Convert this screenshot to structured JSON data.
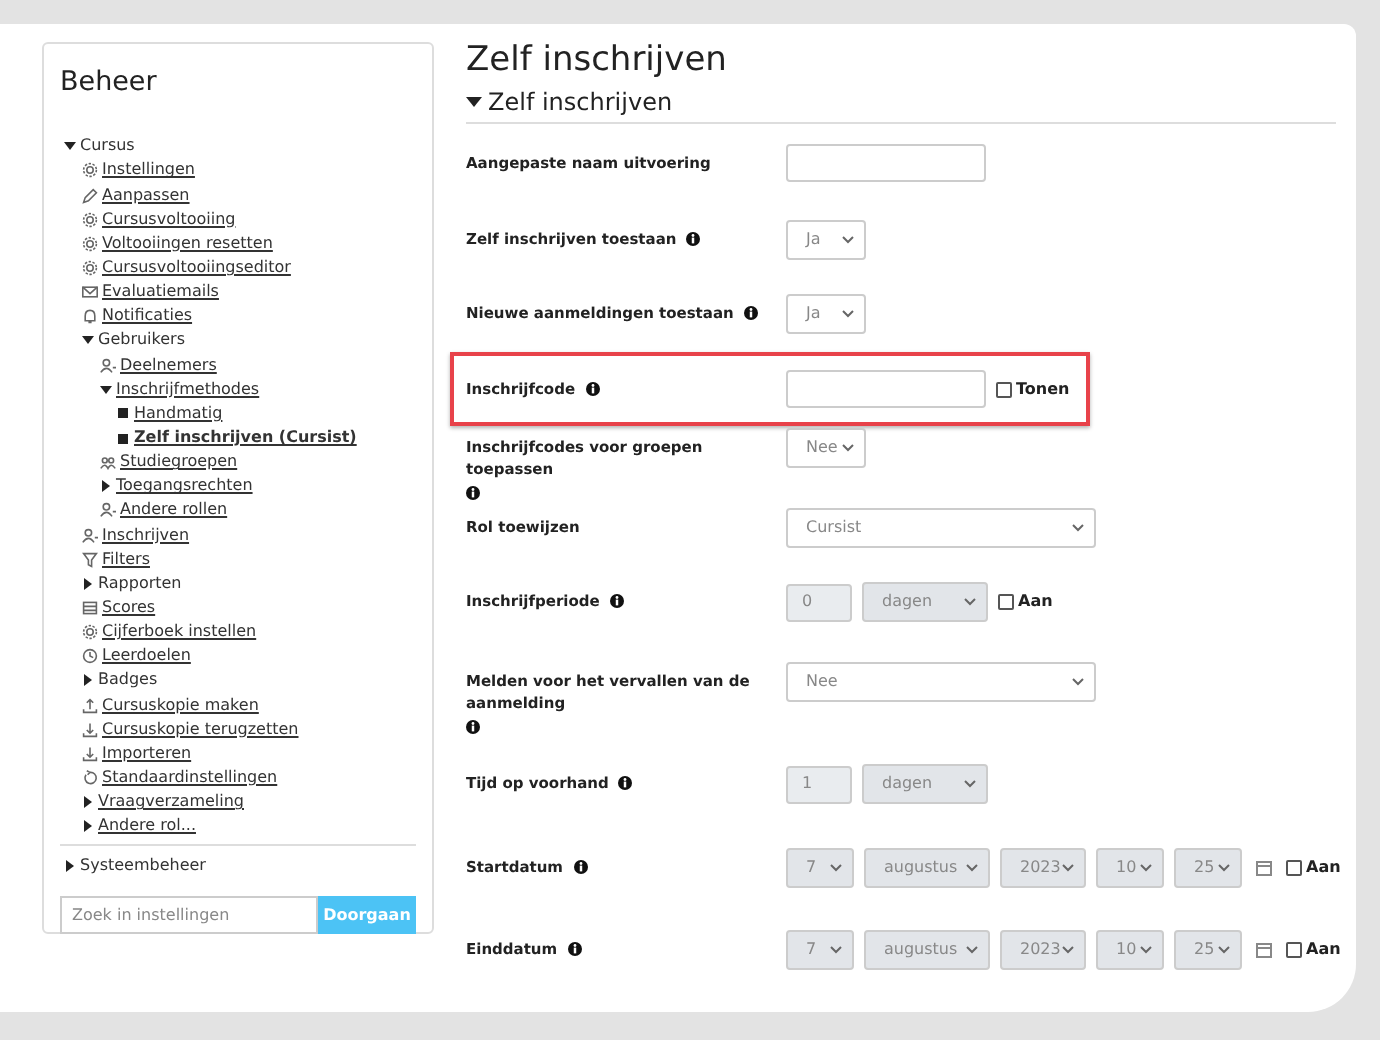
{
  "sidebar": {
    "title": "Beheer",
    "tree": [
      {
        "label": "Cursus",
        "kind": "branch",
        "expanded": true,
        "link": false,
        "selected": false,
        "children": [
          {
            "label": "Instellingen",
            "kind": "gear",
            "link": true,
            "selected": false
          },
          {
            "label": "Aanpassen",
            "kind": "pencil",
            "link": true,
            "selected": false
          },
          {
            "label": "Cursusvoltooiing",
            "kind": "gear",
            "link": true,
            "selected": false
          },
          {
            "label": "Voltooiingen resetten",
            "kind": "gear",
            "link": true,
            "selected": false
          },
          {
            "label": "Cursusvoltooiingseditor",
            "kind": "gear",
            "link": true,
            "selected": false
          },
          {
            "label": "Evaluatiemails",
            "kind": "mail",
            "link": true,
            "selected": false
          },
          {
            "label": "Notificaties",
            "kind": "bell",
            "link": true,
            "selected": false
          },
          {
            "label": "Gebruikers",
            "kind": "branch",
            "expanded": true,
            "link": false,
            "selected": false,
            "children": [
              {
                "label": "Deelnemers",
                "kind": "user",
                "link": true,
                "selected": false
              },
              {
                "label": "Inschrijfmethodes",
                "kind": "branch",
                "expanded": true,
                "link": true,
                "selected": false,
                "children": [
                  {
                    "label": "Handmatig",
                    "kind": "leaf",
                    "link": true,
                    "selected": false
                  },
                  {
                    "label": "Zelf inschrijven (Cursist)",
                    "kind": "leaf",
                    "link": true,
                    "selected": true
                  }
                ]
              },
              {
                "label": "Studiegroepen",
                "kind": "users",
                "link": true,
                "selected": false
              },
              {
                "label": "Toegangsrechten",
                "kind": "branch",
                "expanded": false,
                "link": true,
                "selected": false
              },
              {
                "label": "Andere rollen",
                "kind": "user",
                "link": true,
                "selected": false
              }
            ]
          },
          {
            "label": "Inschrijven",
            "kind": "user",
            "link": true,
            "selected": false
          },
          {
            "label": "Filters",
            "kind": "filter",
            "link": true,
            "selected": false
          },
          {
            "label": "Rapporten",
            "kind": "branch",
            "expanded": false,
            "link": false,
            "selected": false
          },
          {
            "label": "Scores",
            "kind": "table",
            "link": true,
            "selected": false
          },
          {
            "label": "Cijferboek instellen",
            "kind": "gear",
            "link": true,
            "selected": false
          },
          {
            "label": "Leerdoelen",
            "kind": "clock",
            "link": true,
            "selected": false
          },
          {
            "label": "Badges",
            "kind": "branch",
            "expanded": false,
            "link": false,
            "selected": false
          },
          {
            "label": "Cursuskopie maken",
            "kind": "upload",
            "link": true,
            "selected": false
          },
          {
            "label": "Cursuskopie terugzetten",
            "kind": "download",
            "link": true,
            "selected": false
          },
          {
            "label": "Importeren",
            "kind": "download",
            "link": true,
            "selected": false
          },
          {
            "label": "Standaardinstellingen",
            "kind": "reset",
            "link": true,
            "selected": false
          },
          {
            "label": "Vraagverzameling",
            "kind": "branch",
            "expanded": false,
            "link": true,
            "selected": false
          },
          {
            "label": "Andere rol...",
            "kind": "branch",
            "expanded": false,
            "link": true,
            "selected": false
          }
        ]
      }
    ],
    "system": {
      "label": "Systeembeheer",
      "kind": "branch",
      "expanded": false,
      "link": false,
      "selected": false
    },
    "search": {
      "placeholder": "Zoek in instellingen",
      "button": "Doorgaan"
    }
  },
  "page": {
    "title": "Zelf inschrijven",
    "section": {
      "label": "Zelf inschrijven",
      "expanded": true
    },
    "rows": [
      {
        "label": "Aangepaste naam uitvoering",
        "info": false,
        "highlighted": false,
        "controls": [
          {
            "kind": "text",
            "disabled": false
          }
        ]
      },
      {
        "label": "Zelf inschrijven toestaan",
        "info": true,
        "highlighted": false,
        "controls": [
          {
            "kind": "select-short",
            "value": "Ja",
            "disabled": false
          }
        ]
      },
      {
        "label": "Nieuwe aanmeldingen toestaan",
        "info": true,
        "highlighted": false,
        "controls": [
          {
            "kind": "select-short",
            "value": "Ja",
            "disabled": false
          }
        ]
      },
      {
        "label": "Inschrijfcode",
        "info": true,
        "highlighted": true,
        "controls": [
          {
            "kind": "text",
            "disabled": false
          },
          {
            "kind": "checkbox",
            "label": "Tonen",
            "checked": false
          }
        ]
      },
      {
        "label": "Inschrijfcodes voor groepen toepassen",
        "info": true,
        "highlighted": false,
        "controls": [
          {
            "kind": "select-short",
            "value": "Nee",
            "disabled": false
          }
        ]
      },
      {
        "label": "Rol toewijzen",
        "info": false,
        "highlighted": false,
        "controls": [
          {
            "kind": "select-wide",
            "value": "Cursist",
            "disabled": false
          }
        ]
      },
      {
        "label": "Inschrijfperiode",
        "info": true,
        "highlighted": false,
        "controls": [
          {
            "kind": "number",
            "value": "0",
            "disabled": true
          },
          {
            "kind": "select-medium",
            "value": "dagen",
            "disabled": true
          },
          {
            "kind": "checkbox",
            "label": "Aan",
            "checked": false
          }
        ]
      },
      {
        "label": "Melden voor het vervallen van de aanmelding",
        "info": true,
        "highlighted": false,
        "controls": [
          {
            "kind": "select-wide",
            "value": "Nee",
            "disabled": false
          }
        ]
      },
      {
        "label": "Tijd op voorhand",
        "info": true,
        "highlighted": false,
        "controls": [
          {
            "kind": "number",
            "value": "1",
            "disabled": true
          },
          {
            "kind": "select-medium",
            "value": "dagen",
            "disabled": true
          }
        ]
      },
      {
        "label": "Startdatum",
        "info": true,
        "highlighted": false,
        "controls": [
          {
            "kind": "select-tiny",
            "value": "7",
            "disabled": true
          },
          {
            "kind": "select-medium",
            "value": "augustus",
            "disabled": true
          },
          {
            "kind": "select-year",
            "value": "2023",
            "disabled": true
          },
          {
            "kind": "select-tiny",
            "value": "10",
            "disabled": true
          },
          {
            "kind": "select-tiny",
            "value": "25",
            "disabled": true
          },
          {
            "kind": "calendar"
          },
          {
            "kind": "checkbox",
            "label": "Aan",
            "checked": false
          }
        ]
      },
      {
        "label": "Einddatum",
        "info": true,
        "highlighted": false,
        "controls": [
          {
            "kind": "select-tiny",
            "value": "7",
            "disabled": true
          },
          {
            "kind": "select-medium",
            "value": "augustus",
            "disabled": true
          },
          {
            "kind": "select-year",
            "value": "2023",
            "disabled": true
          },
          {
            "kind": "select-tiny",
            "value": "10",
            "disabled": true
          },
          {
            "kind": "select-tiny",
            "value": "25",
            "disabled": true
          },
          {
            "kind": "calendar"
          },
          {
            "kind": "checkbox",
            "label": "Aan",
            "checked": false
          }
        ]
      }
    ]
  }
}
